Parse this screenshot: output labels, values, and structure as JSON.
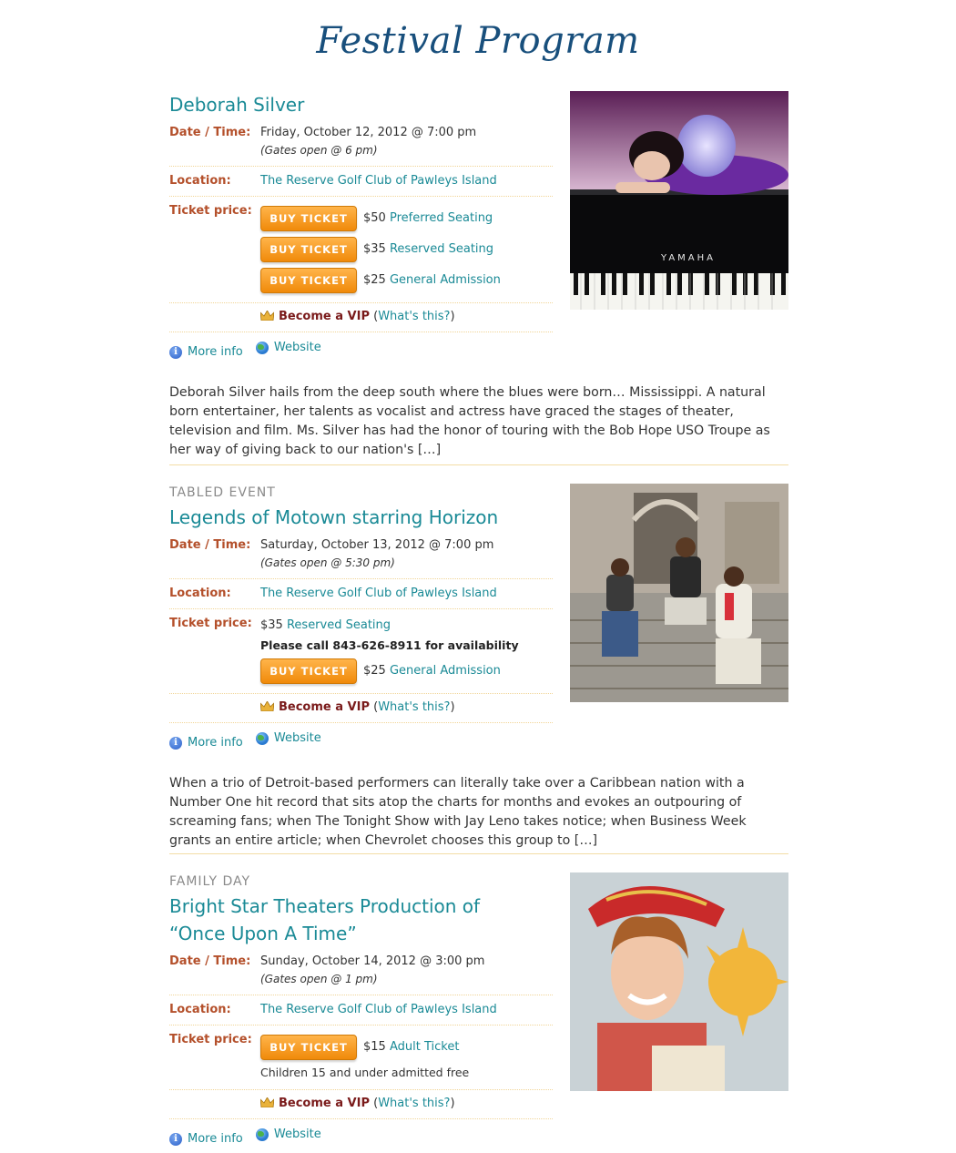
{
  "page": {
    "title": "Festival Program"
  },
  "labels": {
    "date_time": "Date / Time:",
    "location": "Location:",
    "ticket_price": "Ticket price:",
    "buy_ticket": "BUY TICKET",
    "become_vip": "Become a VIP",
    "whats_this": "What's this?",
    "more_info": "More info",
    "website": "Website"
  },
  "events": [
    {
      "category": "",
      "title": "Deborah Silver",
      "datetime": "Friday, October 12, 2012 @ 7:00 pm",
      "gates": "(Gates open @ 6 pm)",
      "location": "The Reserve Golf Club of Pawleys Island",
      "tickets": [
        {
          "price": "$50",
          "type": "Preferred Seating"
        },
        {
          "price": "$35",
          "type": "Reserved Seating"
        },
        {
          "price": "$25",
          "type": "General Admission"
        }
      ],
      "photo_text": "YAMAHA",
      "description": "Deborah Silver hails from the deep south where the blues were born… Mississippi. A natural born entertainer, her talents as vocalist and actress have graced the stages of theater, television and film. Ms. Silver has had the honor of touring with the Bob Hope USO Troupe as her way of giving back to our nation's […]"
    },
    {
      "category": "TABLED EVENT",
      "title": "Legends of Motown starring Horizon",
      "datetime": "Saturday, October 13, 2012 @ 7:00 pm",
      "gates": "(Gates open @ 5:30 pm)",
      "location": "The Reserve Golf Club of Pawleys Island",
      "reserved_price": "$35",
      "reserved_type": "Reserved Seating",
      "call_note": "Please call 843-626-8911 for availability",
      "tickets": [
        {
          "price": "$25",
          "type": "General Admission"
        }
      ],
      "description": "When a trio of Detroit-based performers can literally take over a Caribbean nation with a Number One hit record that sits atop the charts for months and evokes an outpouring of screaming fans; when The Tonight Show with Jay Leno takes notice; when Business Week grants an entire article; when Chevrolet chooses this group to […]"
    },
    {
      "category": "FAMILY DAY",
      "title": "Bright Star Theaters Production of “Once Upon A Time”",
      "datetime": "Sunday, October 14, 2012 @ 3:00 pm",
      "gates": "(Gates open @ 1 pm)",
      "location": "The Reserve Golf Club of Pawleys Island",
      "tickets": [
        {
          "price": "$15",
          "type": "Adult Ticket"
        }
      ],
      "free_note": "Children 15 and under admitted free"
    }
  ]
}
